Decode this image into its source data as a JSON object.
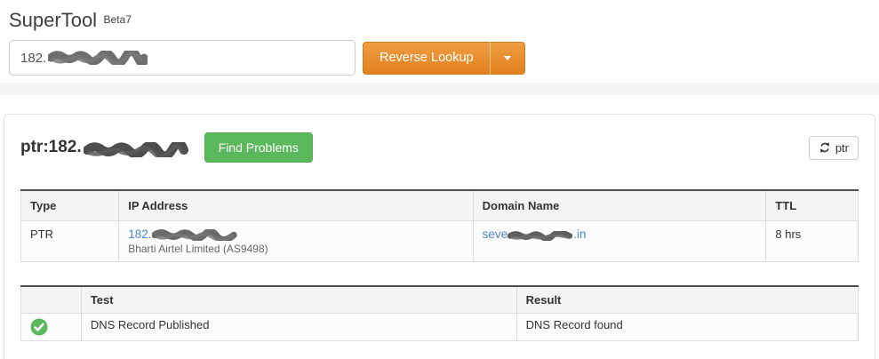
{
  "app": {
    "title": "SuperTool",
    "badge": "Beta7"
  },
  "search": {
    "value_prefix": "182.",
    "button_label": "Reverse Lookup"
  },
  "result_panel": {
    "heading_prefix": "ptr:182.",
    "find_problems_label": "Find Problems",
    "refresh_button_label": "ptr"
  },
  "record_table": {
    "headers": {
      "type": "Type",
      "ip": "IP Address",
      "domain": "Domain Name",
      "ttl": "TTL"
    },
    "row": {
      "type": "PTR",
      "ip_prefix": "182.",
      "ip_owner": "Bharti Airtel Limited (AS9498)",
      "domain_prefix": "seve",
      "domain_suffix": ".in",
      "ttl": "8 hrs"
    }
  },
  "test_table": {
    "headers": {
      "status": "",
      "test": "Test",
      "result": "Result"
    },
    "row": {
      "status": "pass",
      "test": "DNS Record Published",
      "result": "DNS Record found"
    }
  },
  "colors": {
    "accent_orange": "#e6892f",
    "success_green": "#5cb85c",
    "link_blue": "#4a89d0",
    "band_gray": "#f4f4f4"
  }
}
